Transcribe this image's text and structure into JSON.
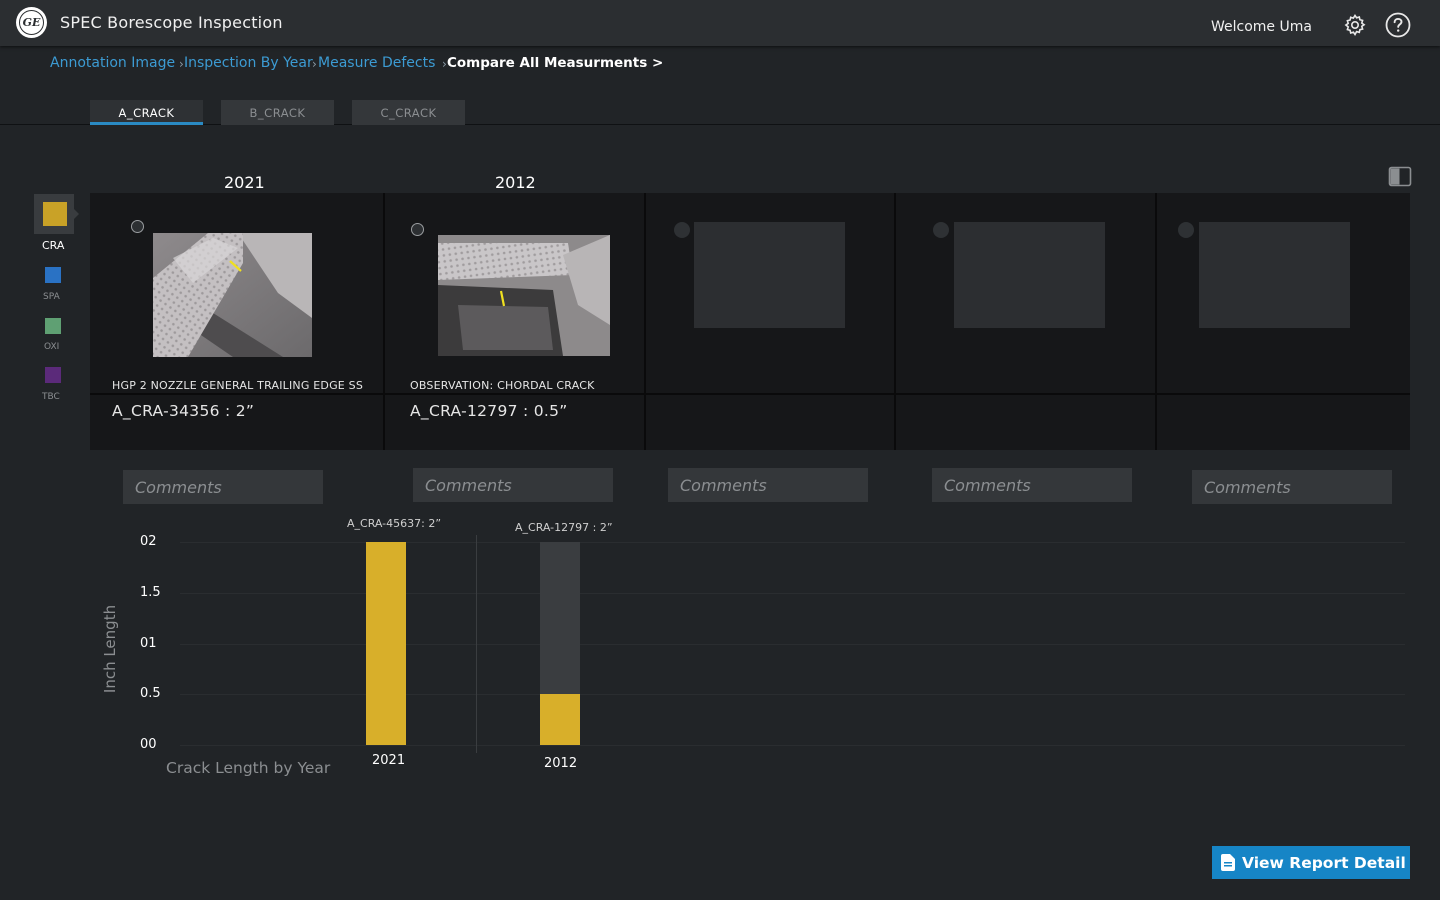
{
  "app": {
    "title": "SPEC Borescope Inspection",
    "logo_text": "GE",
    "welcome": "Welcome Uma",
    "icons": [
      "gear-icon",
      "help-icon"
    ]
  },
  "breadcrumb": {
    "items": [
      "Annotation Image",
      "Inspection By Year",
      "Measure Defects"
    ],
    "separators": [
      "›",
      "›",
      "›"
    ],
    "current": "Compare All Measurments >"
  },
  "tabs": [
    {
      "label": "A_CRACK",
      "active": true
    },
    {
      "label": "B_CRACK",
      "active": false
    },
    {
      "label": "C_CRACK",
      "active": false
    }
  ],
  "legend": [
    {
      "code": "CRA",
      "color": "#c9a227",
      "selected": true
    },
    {
      "code": "SPA",
      "color": "#2a72c4",
      "selected": false
    },
    {
      "code": "OXI",
      "color": "#5fa073",
      "selected": false
    },
    {
      "code": "TBC",
      "color": "#5b2a7a",
      "selected": false
    }
  ],
  "panels": [
    {
      "year": "2021",
      "caption": "HGP 2 NOZZLE GENERAL TRAILING EDGE SS",
      "measurement": "A_CRA-34356 : 2”",
      "comment_placeholder": "Comments"
    },
    {
      "year": "2012",
      "caption": "OBSERVATION:  CHORDAL CRACK",
      "measurement": "A_CRA-12797 : 0.5”",
      "comment_placeholder": "Comments"
    },
    {
      "year": "",
      "caption": "",
      "measurement": "",
      "comment_placeholder": "Comments"
    },
    {
      "year": "",
      "caption": "",
      "measurement": "",
      "comment_placeholder": "Comments"
    },
    {
      "year": "",
      "caption": "",
      "measurement": "",
      "comment_placeholder": "Comments"
    }
  ],
  "chart_data": {
    "type": "bar",
    "title": "Crack Length by Year",
    "ylabel": "Inch Length",
    "ylim": [
      0,
      2
    ],
    "y_ticks": [
      "00",
      "0.5",
      "01",
      "1.5",
      "02"
    ],
    "categories": [
      "2021",
      "2012"
    ],
    "values": [
      2,
      0.5
    ],
    "bar_labels": [
      "A_CRA-45637: 2”",
      "A_CRA-12797 : 2”"
    ],
    "bar_color": "#d8af2a",
    "track_color": "#3a3d40",
    "grid": true
  },
  "actions": {
    "view_report": "View Report Detail"
  }
}
